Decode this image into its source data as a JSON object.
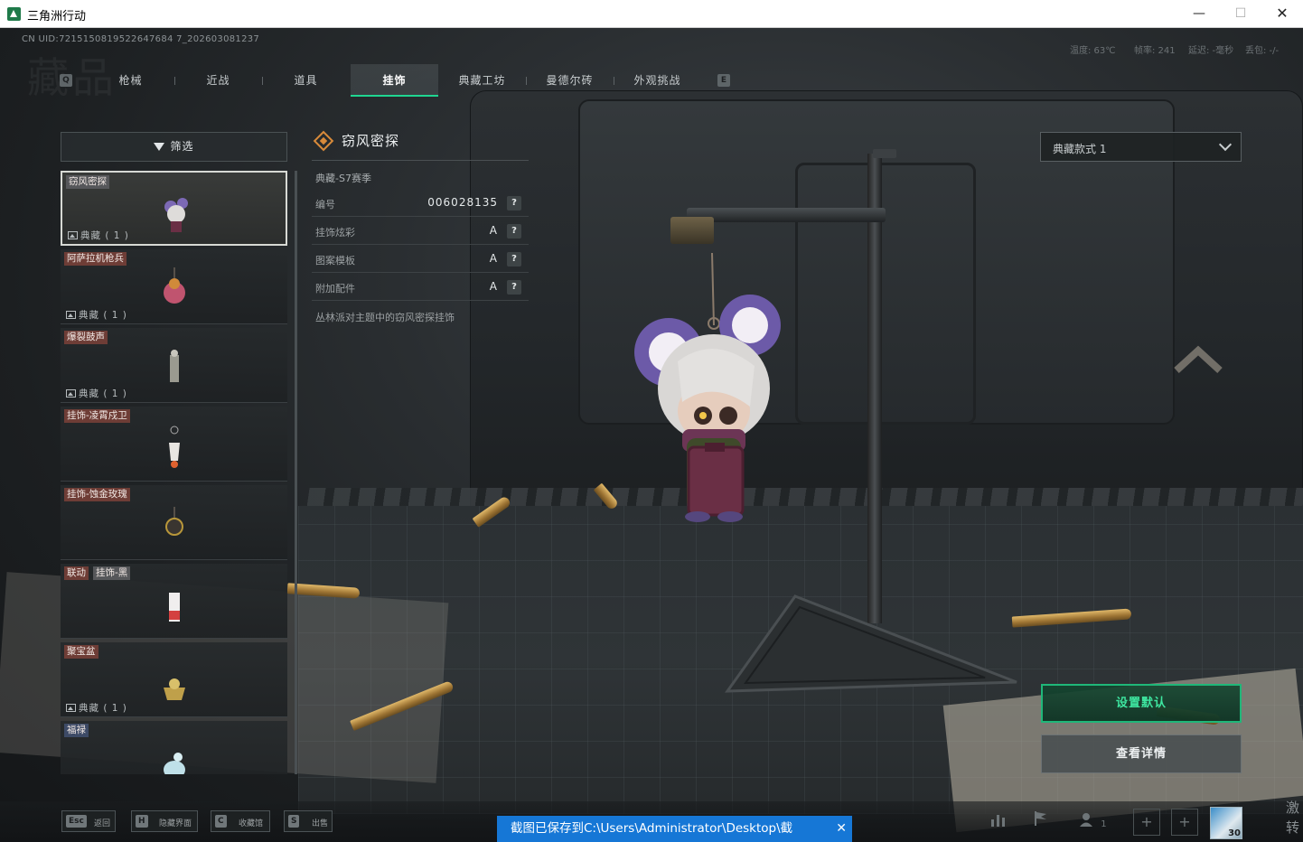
{
  "window": {
    "title": "三角洲行动",
    "minimize": "—",
    "maximize": "☐",
    "close": "✕"
  },
  "hud": {
    "uid": "CN UID:7215150819522647684 7_202603081237",
    "temp": "温度: 63℃",
    "fps": "帧率: 241",
    "latency": "延迟: -毫秒",
    "packet_loss": "丢包: -/-",
    "watermark": "藏品"
  },
  "tabs": {
    "prev_key": "Q",
    "next_key": "E",
    "items": [
      "枪械",
      "近战",
      "道具",
      "挂饰",
      "典藏工坊",
      "曼德尔砖",
      "外观挑战"
    ],
    "active_index": 3
  },
  "filter": {
    "label": "筛选"
  },
  "list": {
    "items": [
      {
        "name": "窃风密探",
        "count": "典藏 ( 1 )",
        "selected": true
      },
      {
        "name": "阿萨拉机枪兵",
        "count": "典藏 ( 1 )"
      },
      {
        "name": "爆裂鼓声",
        "count": "典藏 ( 1 )"
      },
      {
        "name": "挂饰-凌霄戍卫",
        "count": ""
      },
      {
        "name": "挂饰-蚀金玫瑰",
        "count": ""
      },
      {
        "name": "联动",
        "name2": "挂饰-黑",
        "count": ""
      },
      {
        "name": "聚宝盆",
        "count": "典藏 ( 1 )"
      },
      {
        "name": "福禄",
        "count": ""
      }
    ]
  },
  "detail": {
    "title": "窃风密探",
    "season": "典藏-S7赛季",
    "attributes": [
      {
        "label": "编号",
        "value": "006028135"
      },
      {
        "label": "挂饰炫彩",
        "value": "A"
      },
      {
        "label": "图案模板",
        "value": "A"
      },
      {
        "label": "附加配件",
        "value": "A"
      }
    ],
    "help": "?",
    "description": "丛林派对主题中的窃风密探挂饰"
  },
  "style_select": {
    "value": "典藏款式 1"
  },
  "actions": {
    "set_default": "设置默认",
    "view_detail": "查看详情"
  },
  "bottom_hints": [
    {
      "key": "Esc",
      "label": "返回"
    },
    {
      "key": "H",
      "label": "隐藏界面"
    },
    {
      "key": "C",
      "label": "收藏馆"
    },
    {
      "key": "S",
      "label": "出售"
    }
  ],
  "toast": {
    "text": "截图已保存到C:\\Users\\Administrator\\Desktop\\截",
    "close": "✕"
  },
  "bottom_right": {
    "party_count": "1",
    "avatar_level": "30",
    "edge_text_1": "激",
    "edge_text_2": "转"
  },
  "colors": {
    "accent_green": "#1fd691",
    "tag_brown": "#6e3d36",
    "toast_blue": "#1677d6",
    "detail_icon_orange": "#d88a3a"
  }
}
